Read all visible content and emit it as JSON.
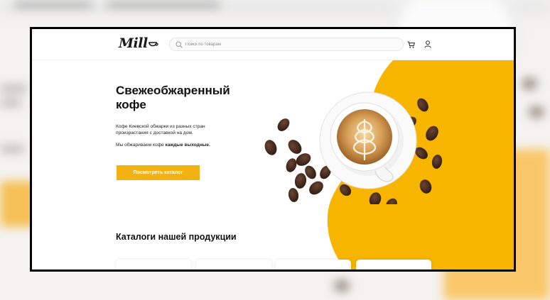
{
  "header": {
    "logo_text": "Mill",
    "search_placeholder": "Поиск по товарам"
  },
  "hero": {
    "title_line1": "Свежеобжаренный",
    "title_line2": "кофе",
    "description": "Кофе Киевской обжарки из разных стран произрастания с доставкой на дом.",
    "note_prefix": "Мы обжариваем кофе ",
    "note_bold": "каждые выходные.",
    "cta_label": "Посмотреть каталог"
  },
  "catalog": {
    "title": "Каталоги нашей продукции",
    "card_count": 4
  },
  "colors": {
    "accent": "#f2b211",
    "shape_yellow": "#f7b500",
    "text": "#111111"
  },
  "icons": [
    "search-icon",
    "cart-icon",
    "user-icon"
  ]
}
